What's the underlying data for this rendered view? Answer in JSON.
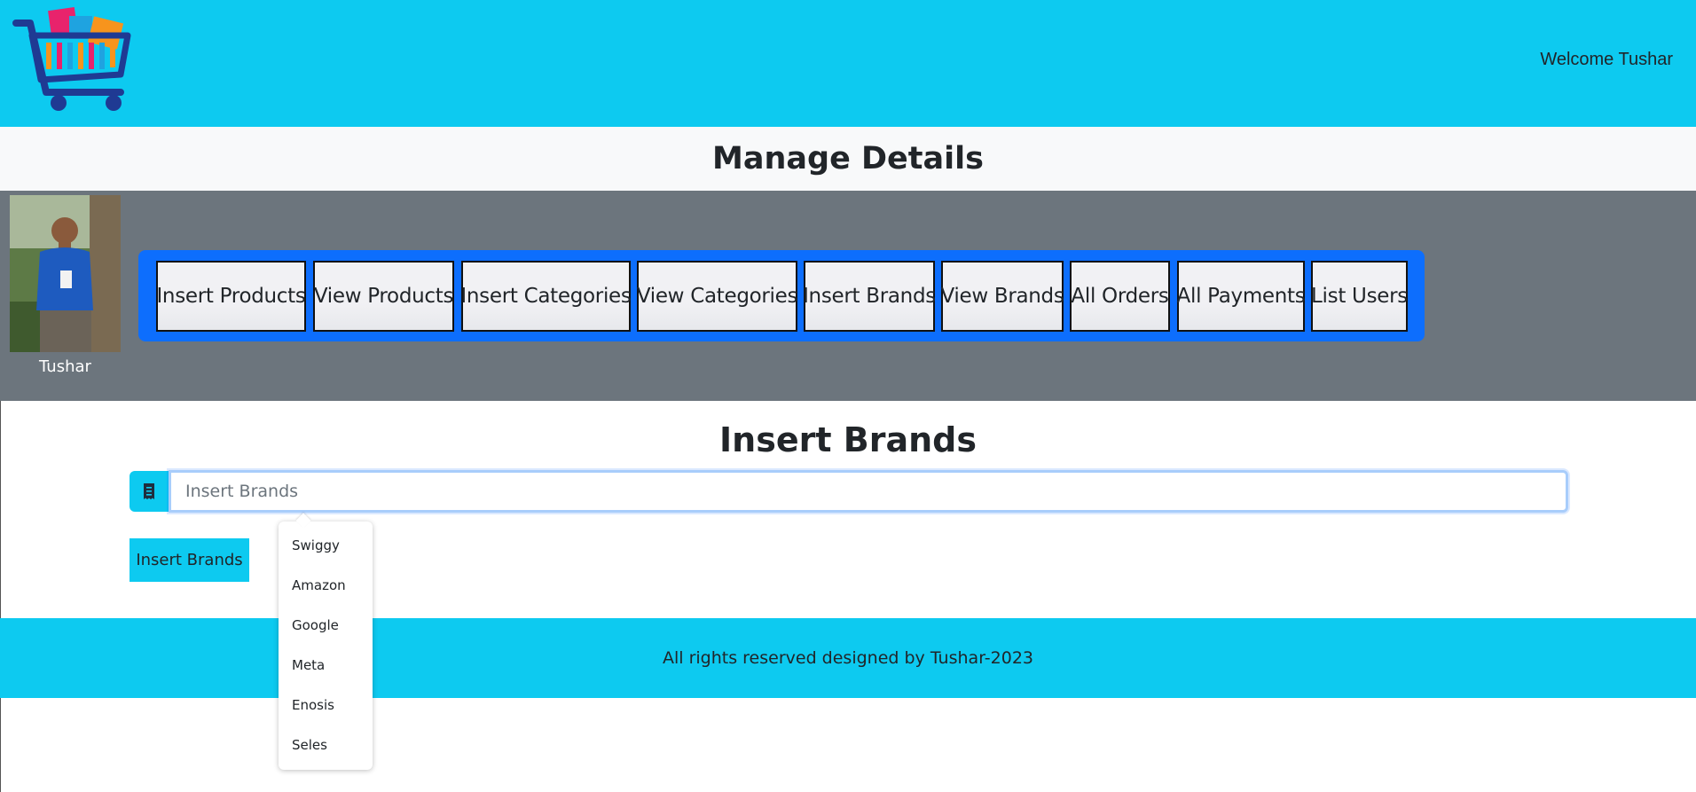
{
  "header": {
    "welcome_text": "Welcome Tushar",
    "background_color": "#0dcaf0",
    "logo_icon": "shopping-cart-icon"
  },
  "subheader": {
    "title": "Manage Details"
  },
  "admin": {
    "name": "Tushar",
    "avatar_icon": "user-photo",
    "nav_buttons": [
      "Insert Products",
      "View Products",
      "Insert Categories",
      "View Categories",
      "Insert Brands",
      "View Brands",
      "All Orders",
      "All Payments",
      "List Users"
    ],
    "panel_color": "#0d6efd",
    "band_color": "#6c757d"
  },
  "form": {
    "title": "Insert Brands",
    "input_placeholder": "Insert Brands",
    "addon_icon": "receipt-icon",
    "submit_label": "Insert Brands"
  },
  "autocomplete": {
    "options": [
      "Swiggy",
      "Amazon",
      "Google",
      "Meta",
      "Enosis",
      "Seles"
    ]
  },
  "footer": {
    "text": "All rights reserved designed by Tushar-2023"
  }
}
